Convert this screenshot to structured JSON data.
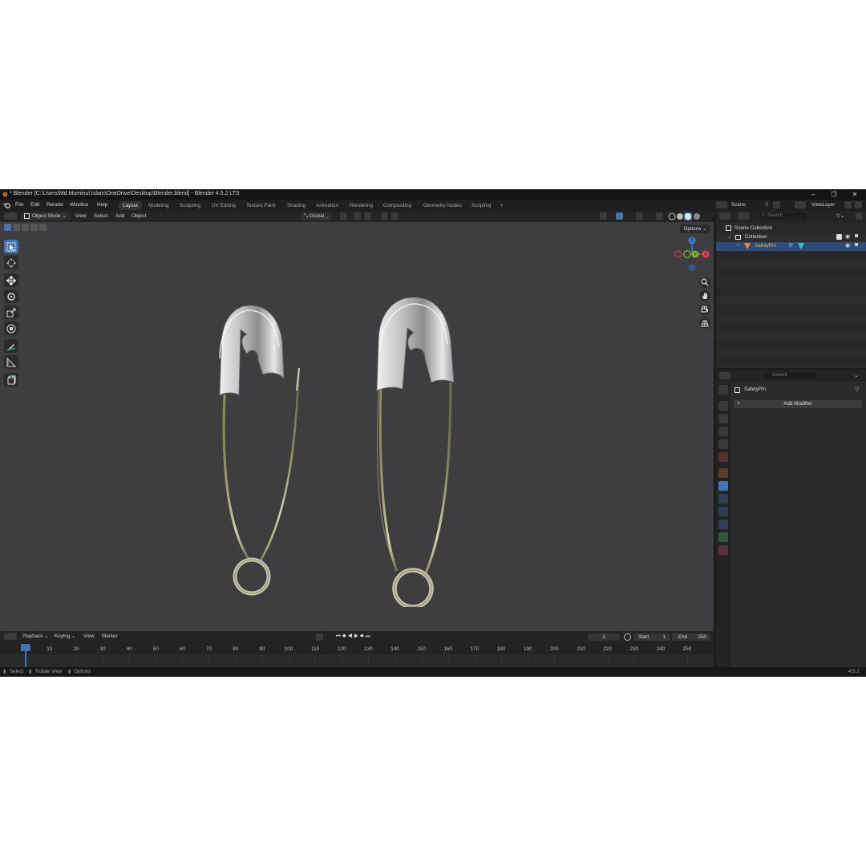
{
  "window": {
    "title": "* Blender [C:\\Users\\Md.Mominul Islam\\OneDrive\\Desktop\\Blender.blend] - Blender 4.5.2 LTS"
  },
  "menu": [
    "File",
    "Edit",
    "Render",
    "Window",
    "Help"
  ],
  "workspaces": [
    {
      "label": "Layout",
      "active": true
    },
    {
      "label": "Modeling",
      "active": false
    },
    {
      "label": "Sculpting",
      "active": false
    },
    {
      "label": "UV Editing",
      "active": false
    },
    {
      "label": "Texture Paint",
      "active": false
    },
    {
      "label": "Shading",
      "active": false
    },
    {
      "label": "Animation",
      "active": false
    },
    {
      "label": "Rendering",
      "active": false
    },
    {
      "label": "Compositing",
      "active": false
    },
    {
      "label": "Geometry Nodes",
      "active": false
    },
    {
      "label": "Scripting",
      "active": false
    }
  ],
  "workspace_add": "+",
  "scene": {
    "label": "Scene",
    "viewlayer": "ViewLayer"
  },
  "viewport_header": {
    "mode": "Object Mode",
    "menus": [
      "View",
      "Select",
      "Add",
      "Object"
    ],
    "orientation": "Global",
    "options": "Options"
  },
  "gizmo_axes": {
    "x": "X",
    "y": "Y",
    "z": "Z"
  },
  "outliner": {
    "search_placeholder": "Search",
    "scene_collection": "Scene Collection",
    "collection": "Collection",
    "object": "SafetyPin"
  },
  "properties": {
    "search_placeholder": "Search",
    "object_name": "SafetyPin",
    "add_modifier": "Add Modifier"
  },
  "timeline": {
    "menus": [
      "Playback",
      "Keying",
      "View",
      "Marker"
    ],
    "current_frame": "1",
    "start_label": "Start",
    "start": "1",
    "end_label": "End",
    "end": "250",
    "ticks": [
      "1",
      "10",
      "20",
      "30",
      "40",
      "50",
      "60",
      "70",
      "80",
      "90",
      "100",
      "110",
      "120",
      "130",
      "140",
      "150",
      "160",
      "170",
      "180",
      "190",
      "200",
      "210",
      "220",
      "230",
      "240",
      "250"
    ]
  },
  "statusbar": {
    "select": "Select",
    "rotate": "Rotate View",
    "options": "Options",
    "version": "4.5.2"
  },
  "colors": {
    "accent": "#4772b3",
    "axis_x": "#e0424e",
    "axis_y": "#7db22d",
    "axis_z": "#3f7ed8",
    "viewport_bg": "#3e3e40"
  }
}
